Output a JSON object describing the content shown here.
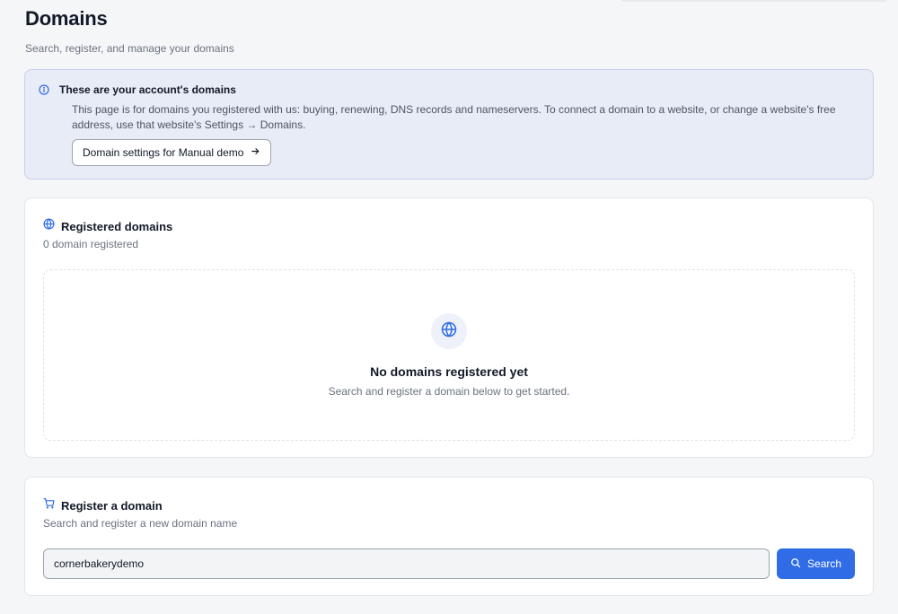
{
  "page": {
    "title": "Domains",
    "subtitle": "Search, register, and manage your domains"
  },
  "banner": {
    "icon": "info-icon",
    "title": "These are your account's domains",
    "body": "This page is for domains you registered with us: buying, renewing, DNS records and nameservers. To connect a domain to a website, or change a website's free address, use that website's Settings → Domains.",
    "button_label": "Domain settings for Manual demo",
    "button_icon": "arrow-right-icon"
  },
  "registered": {
    "icon": "globe-icon",
    "title": "Registered domains",
    "count_text": "0 domain registered",
    "empty_title": "No domains registered yet",
    "empty_sub": "Search and register a domain below to get started."
  },
  "register": {
    "icon": "cart-icon",
    "title": "Register a domain",
    "subtitle": "Search and register a new domain name",
    "input_value": "cornerbakerydemo",
    "search_label": "Search",
    "search_icon": "search-icon"
  },
  "colors": {
    "accent": "#2f6ce5",
    "banner_bg": "#e8ecf7",
    "banner_border": "#c5d0ec",
    "page_bg": "#f5f6f8"
  }
}
